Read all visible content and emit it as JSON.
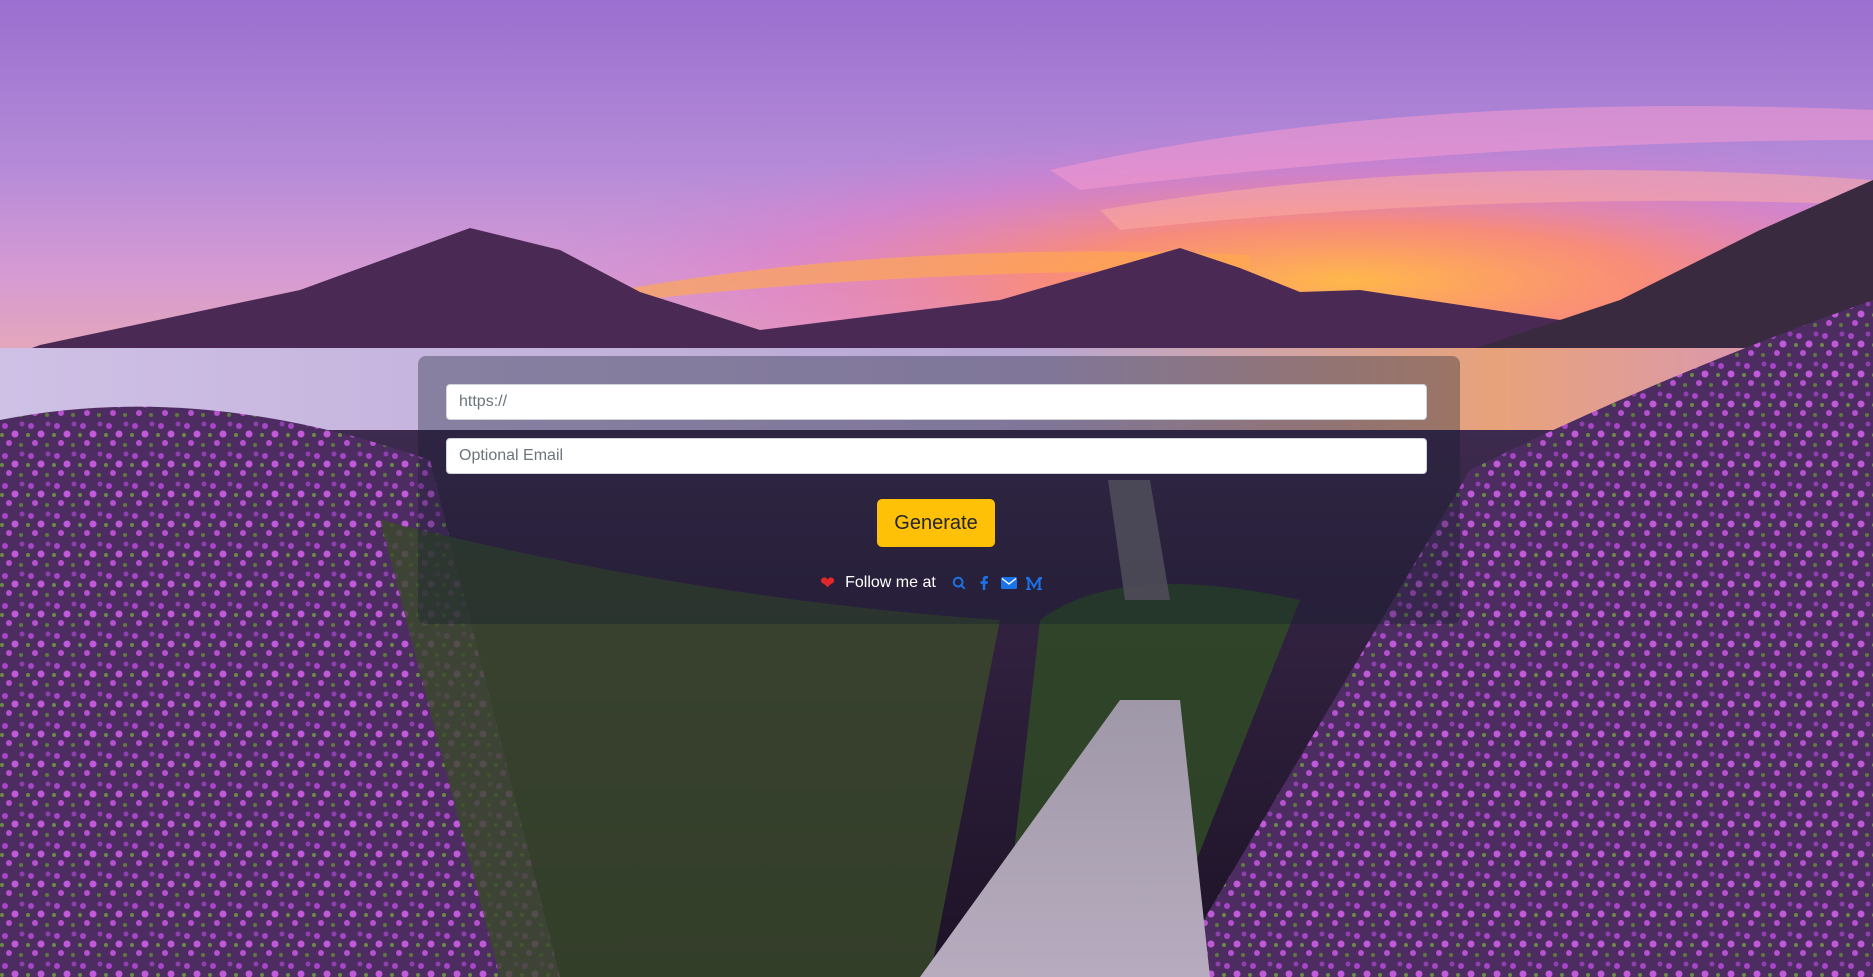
{
  "form": {
    "url_placeholder": "https://",
    "email_placeholder": "Optional Email",
    "generate_label": "Generate"
  },
  "footer": {
    "follow_text": "Follow me at",
    "heart_icon": "heart-icon",
    "social_icons": [
      "github-icon",
      "facebook-icon",
      "email-icon",
      "medium-icon"
    ]
  },
  "colors": {
    "button": "#ffc107",
    "social_icon": "#1a73e8",
    "heart": "#e0282a"
  }
}
